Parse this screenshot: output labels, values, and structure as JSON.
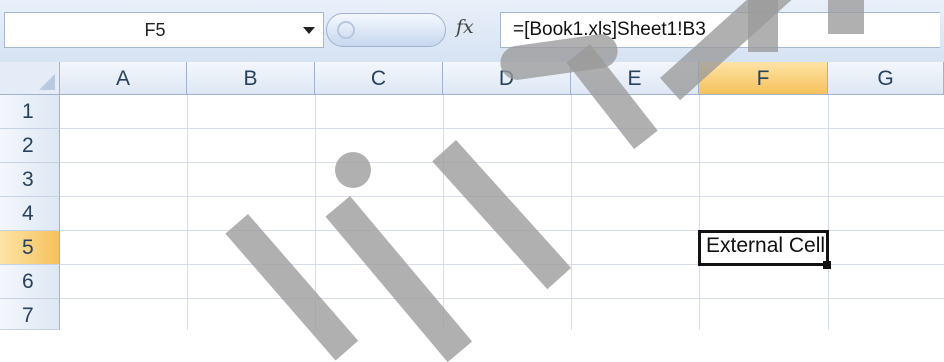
{
  "name_box": {
    "value": "F5"
  },
  "formula_bar": {
    "fx_label": "fx",
    "formula": "=[Book1.xls]Sheet1!B3"
  },
  "columns": [
    "A",
    "B",
    "C",
    "D",
    "E",
    "F",
    "G"
  ],
  "rows": [
    "1",
    "2",
    "3",
    "4",
    "5",
    "6",
    "7"
  ],
  "selection": {
    "column": "F",
    "row": "5"
  },
  "cells": {
    "F5": "External Cell"
  },
  "colors": {
    "header_highlight": "#f6c15c",
    "grid_line": "#d6dde8"
  }
}
